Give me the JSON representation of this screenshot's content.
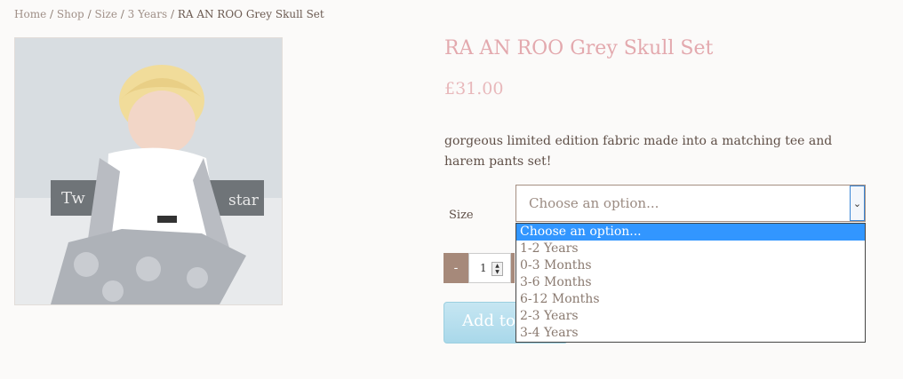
{
  "breadcrumb": {
    "items": [
      "Home",
      "Shop",
      "Size",
      "3 Years"
    ],
    "separator": "/",
    "current": "RA AN ROO Grey Skull Set"
  },
  "product": {
    "image_text_left": "Tw",
    "image_text_right": "star",
    "title": "RA AN ROO Grey Skull Set",
    "price": "£31.00",
    "description": "gorgeous limited edition fabric made into a matching tee and harem pants set!"
  },
  "size": {
    "label": "Size",
    "selected": "Choose an option...",
    "options": [
      "Choose an option...",
      "1-2 Years",
      "0-3 Months",
      "3-6 Months",
      "6-12 Months",
      "2-3 Years",
      "3-4 Years"
    ],
    "highlighted_index": 0
  },
  "quantity": {
    "minus_label": "-",
    "value": "1"
  },
  "add_to_cart": {
    "label": "Add to"
  },
  "colors": {
    "title": "#e3a9ae",
    "price": "#e8b8bb",
    "qty_button": "#a6897a",
    "option_highlight": "#3296ff",
    "add_button": "#b4dfee"
  },
  "icons": {
    "select_arrow": "chevron-down-icon",
    "spinner": "up-down-spinner-icon"
  }
}
